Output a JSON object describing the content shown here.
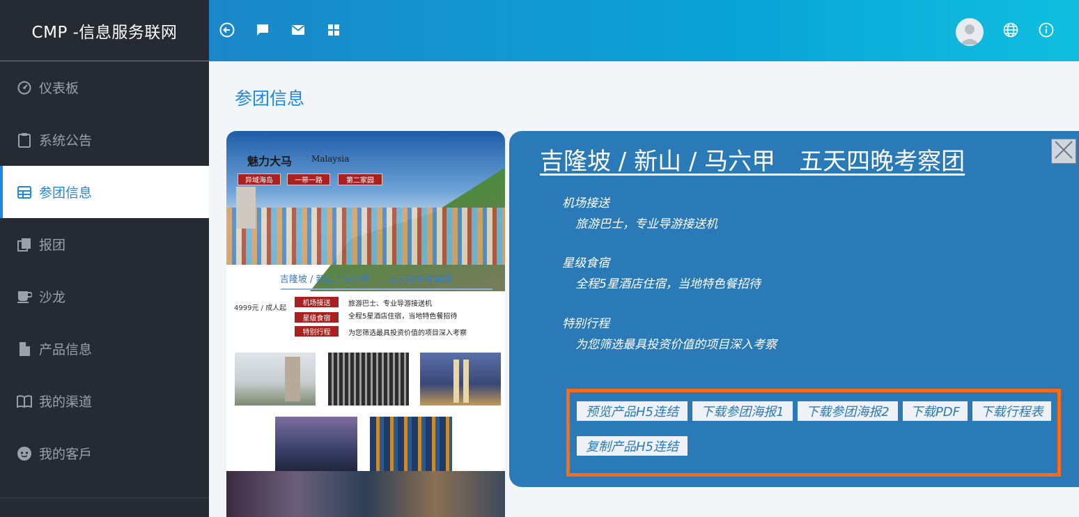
{
  "app": {
    "title": "CMP -信息服务联网"
  },
  "sidebar": {
    "items": [
      {
        "label": "仪表板",
        "icon": "dashboard-icon"
      },
      {
        "label": "系统公告",
        "icon": "clipboard-icon"
      },
      {
        "label": "参团信息",
        "icon": "table-icon",
        "active": true
      },
      {
        "label": "报团",
        "icon": "stack-icon"
      },
      {
        "label": "沙龙",
        "icon": "coffee-cup-icon"
      },
      {
        "label": "产品信息",
        "icon": "file-icon"
      },
      {
        "label": "我的渠道",
        "icon": "book-icon"
      },
      {
        "label": "我的客戶",
        "icon": "face-icon"
      }
    ]
  },
  "topbar": {
    "left_icons": [
      "back-circle-icon",
      "chat-icon",
      "mail-icon",
      "grid-icon"
    ],
    "right_icons": [
      "avatar",
      "globe-icon",
      "info-icon"
    ]
  },
  "page": {
    "title": "参团信息"
  },
  "poster": {
    "logo": "魅力大马",
    "logo_sub": "Malaysia",
    "tags": [
      "异域海岛",
      "一带一路",
      "第二家园"
    ],
    "route": "吉隆坡 / 新山 / 马六甲　　五天四晚考察团",
    "price": "4999元 / 成人起",
    "features": [
      {
        "tag": "机场接送",
        "desc": "旅游巴士、专业导游接送机"
      },
      {
        "tag": "星级食宿",
        "desc": "全程5星酒店住宿，当地特色餐招待"
      },
      {
        "tag": "特别行程",
        "desc": "为您筛选最具投资价值的项目深入考察"
      }
    ]
  },
  "detail": {
    "title": "吉隆坡 / 新山 / 马六甲　五天四晚考察团",
    "features": [
      {
        "title": "机场接送",
        "desc": "旅游巴士，专业导游接送机"
      },
      {
        "title": "星级食宿",
        "desc": "全程5星酒店住宿，当地特色餐招待"
      },
      {
        "title": "特别行程",
        "desc": "为您筛选最具投资价值的项目深入考察"
      }
    ],
    "actions": {
      "preview": "预览产品H5连结",
      "poster1": "下载参团海报1",
      "poster2": "下载参团海报2",
      "pdf": "下载PDF",
      "itinerary": "下载行程表",
      "copy": "复制产品H5连结"
    }
  },
  "colors": {
    "sidebar_bg": "#262a33",
    "accent": "#1e88e5",
    "panel_bg": "#2b7ab8",
    "highlight": "#ff6a13"
  }
}
